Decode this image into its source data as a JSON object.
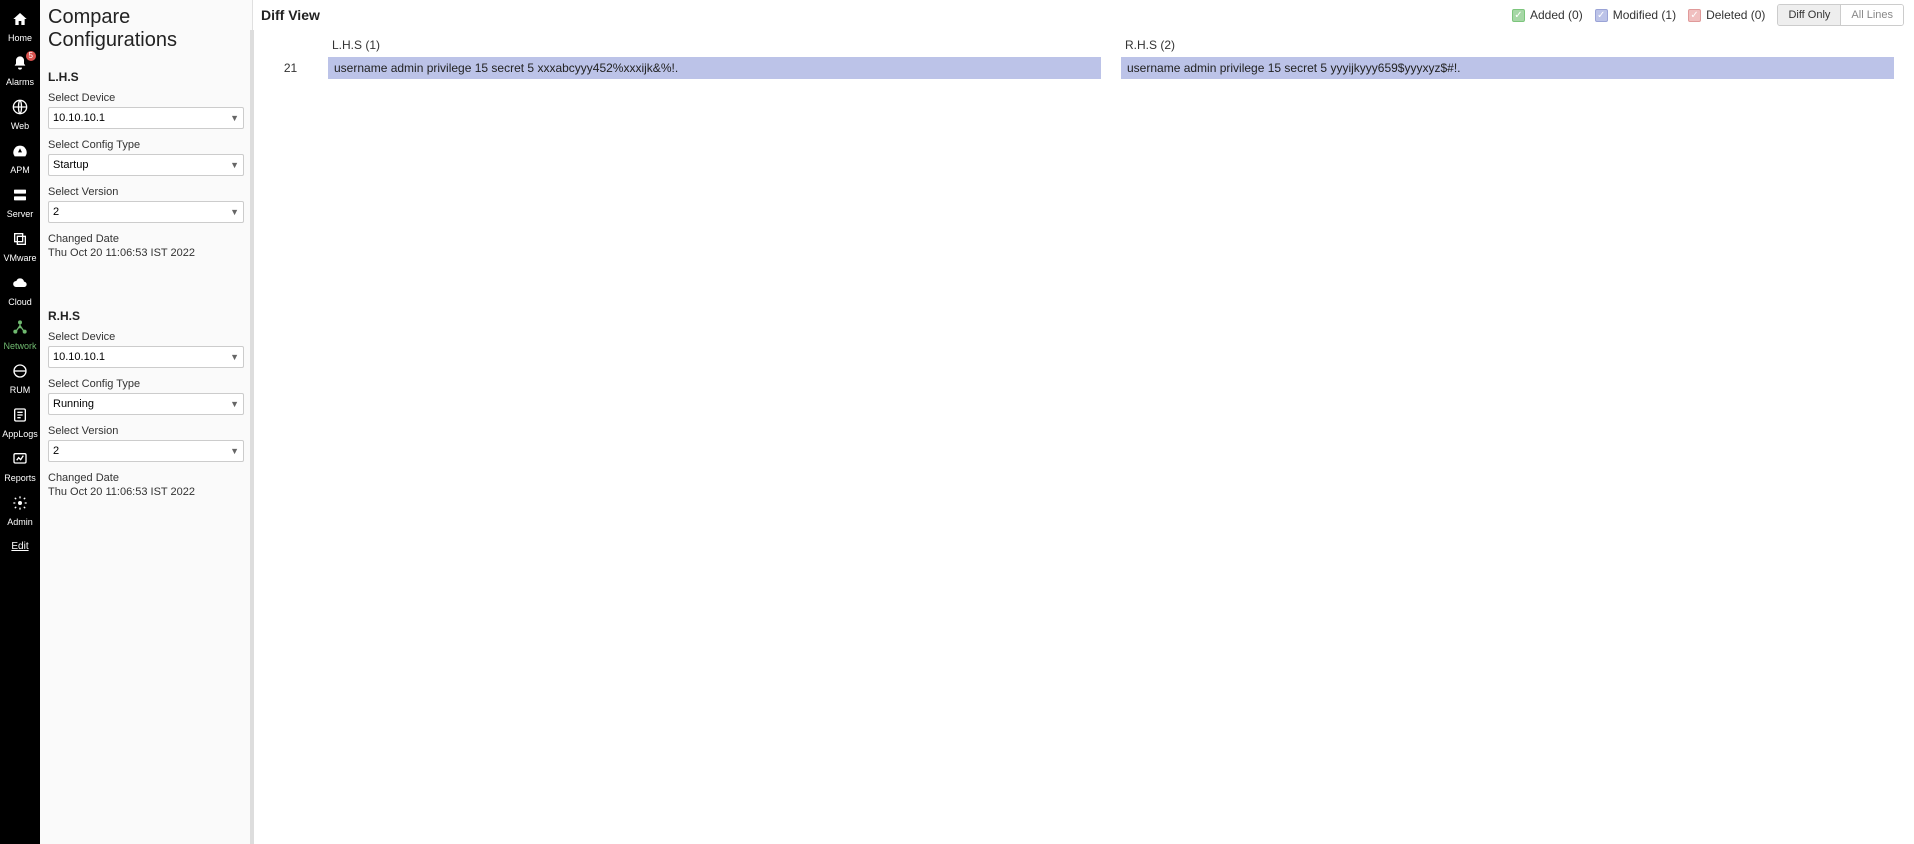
{
  "sidenav": {
    "items": [
      {
        "label": "Home",
        "icon": "home"
      },
      {
        "label": "Alarms",
        "icon": "bell",
        "badge": "5"
      },
      {
        "label": "Web",
        "icon": "globe"
      },
      {
        "label": "APM",
        "icon": "gauge"
      },
      {
        "label": "Server",
        "icon": "server"
      },
      {
        "label": "VMware",
        "icon": "stack"
      },
      {
        "label": "Cloud",
        "icon": "cloud"
      },
      {
        "label": "Network",
        "icon": "network",
        "active": true
      },
      {
        "label": "RUM",
        "icon": "globe2"
      },
      {
        "label": "AppLogs",
        "icon": "logs"
      },
      {
        "label": "Reports",
        "icon": "report"
      },
      {
        "label": "Admin",
        "icon": "gear"
      }
    ],
    "edit": "Edit"
  },
  "config": {
    "title": "Compare Configurations",
    "lhs": {
      "heading": "L.H.S",
      "device_label": "Select Device",
      "device_value": "10.10.10.1",
      "type_label": "Select Config Type",
      "type_value": "Startup",
      "version_label": "Select Version",
      "version_value": "2",
      "changed_label": "Changed Date",
      "changed_value": "Thu Oct 20 11:06:53 IST 2022"
    },
    "rhs": {
      "heading": "R.H.S",
      "device_label": "Select Device",
      "device_value": "10.10.10.1",
      "type_label": "Select Config Type",
      "type_value": "Running",
      "version_label": "Select Version",
      "version_value": "2",
      "changed_label": "Changed Date",
      "changed_value": "Thu Oct 20 11:06:53 IST 2022"
    }
  },
  "diff": {
    "title": "Diff View",
    "legend": {
      "added": "Added (0)",
      "modified": "Modified (1)",
      "deleted": "Deleted (0)"
    },
    "toggle": {
      "diff_only": "Diff Only",
      "all_lines": "All Lines"
    },
    "col_lhs": "L.H.S (1)",
    "col_rhs": "R.H.S (2)",
    "rows": [
      {
        "line": "21",
        "lhs": "username admin privilege 15 secret 5 xxxabcyyy452%xxxijk&%!.",
        "rhs": "username admin privilege 15 secret 5 yyyijkyyy659$yyyxyz$#!."
      }
    ]
  }
}
